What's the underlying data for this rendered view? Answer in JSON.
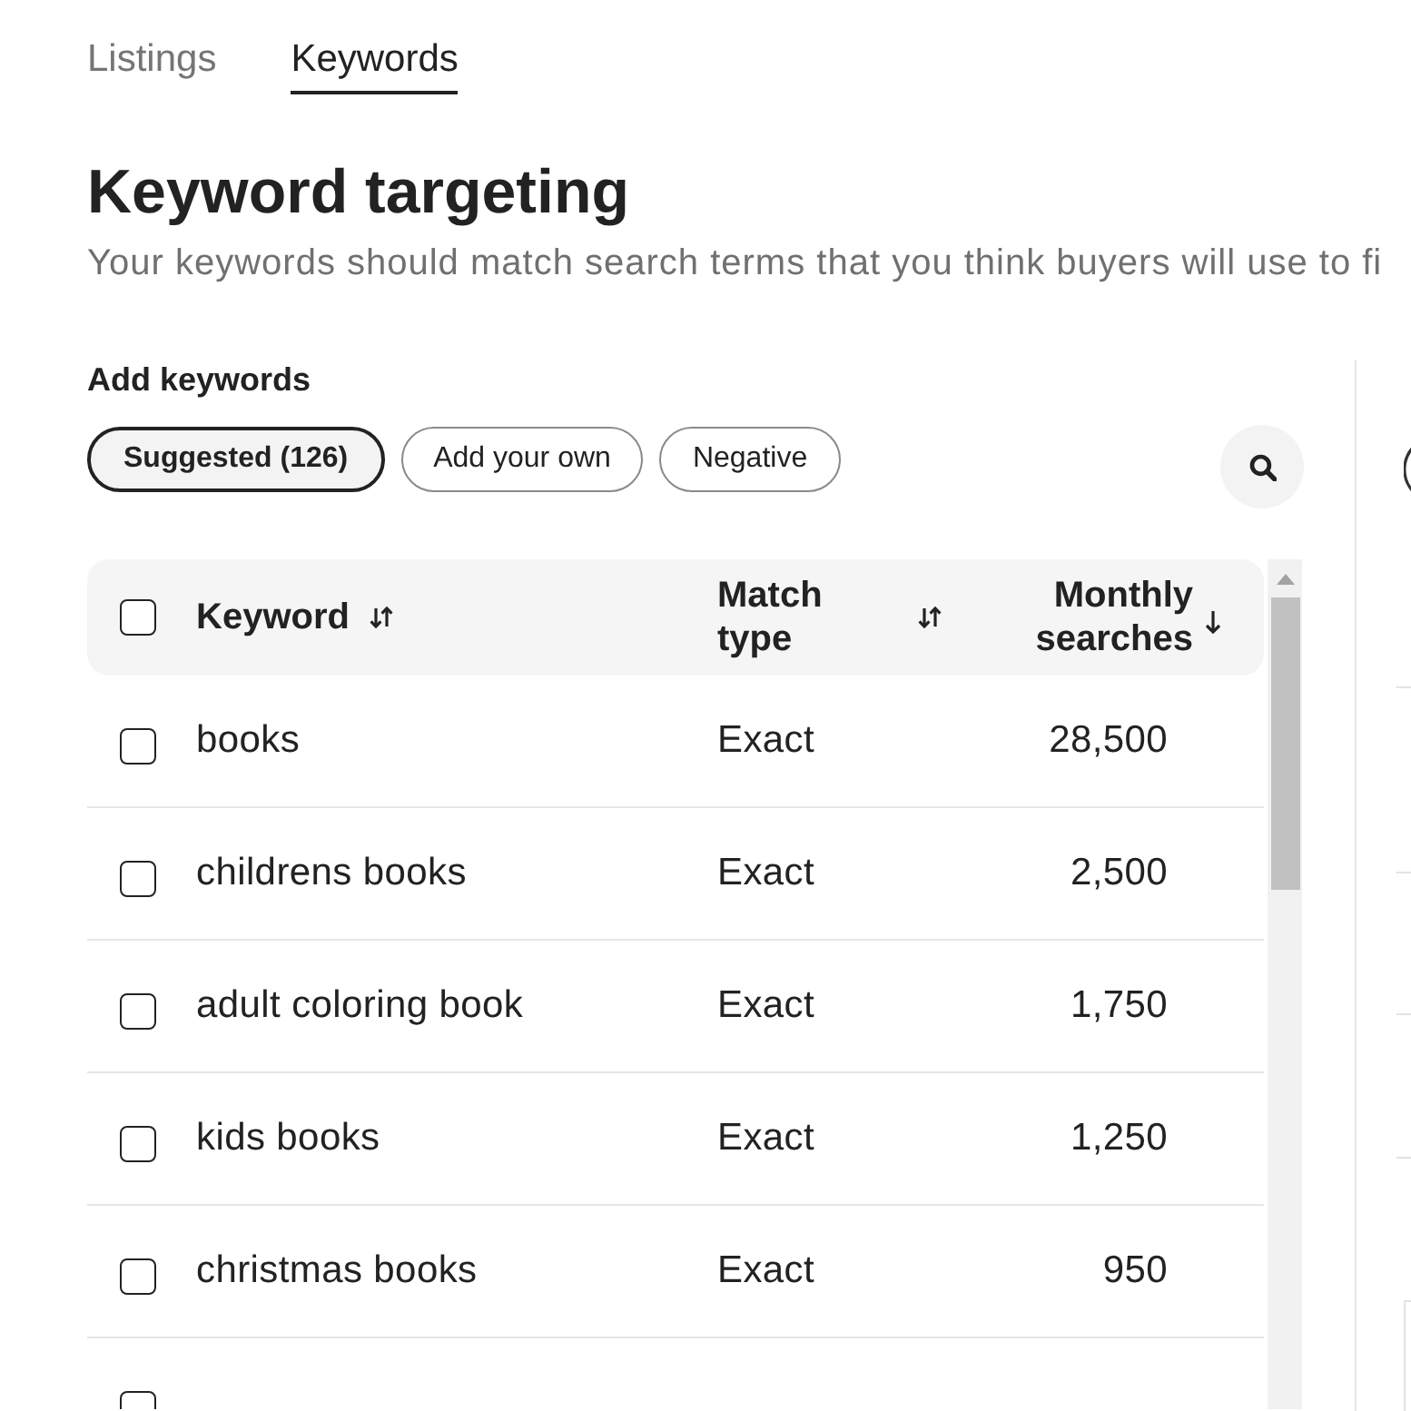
{
  "tabs": [
    {
      "label": "Listings",
      "selected": false
    },
    {
      "label": "Keywords",
      "selected": true
    }
  ],
  "heading": "Keyword targeting",
  "subtitle": "Your keywords should match search terms that you think buyers will use to fi",
  "add_keywords": {
    "label": "Add keywords",
    "filters": [
      {
        "label": "Suggested (126)",
        "selected": true
      },
      {
        "label": "Add your own",
        "selected": false
      },
      {
        "label": "Negative",
        "selected": false
      }
    ]
  },
  "table": {
    "select_all": {
      "checked": false
    },
    "columns": [
      {
        "label": "Keyword",
        "sorted": false
      },
      {
        "label": "Match type",
        "sorted": false
      },
      {
        "label": "Monthly searches",
        "sorted": true
      }
    ],
    "rows": [
      {
        "keyword": "books",
        "match_type": "Exact",
        "monthly_searches": "28,500",
        "checked": false
      },
      {
        "keyword": "childrens books",
        "match_type": "Exact",
        "monthly_searches": "2,500",
        "checked": false
      },
      {
        "keyword": "adult coloring book",
        "match_type": "Exact",
        "monthly_searches": "1,750",
        "checked": false
      },
      {
        "keyword": "kids books",
        "match_type": "Exact",
        "monthly_searches": "1,250",
        "checked": false
      },
      {
        "keyword": "christmas books",
        "match_type": "Exact",
        "monthly_searches": "950",
        "checked": false
      },
      {
        "checked": false
      }
    ]
  }
}
